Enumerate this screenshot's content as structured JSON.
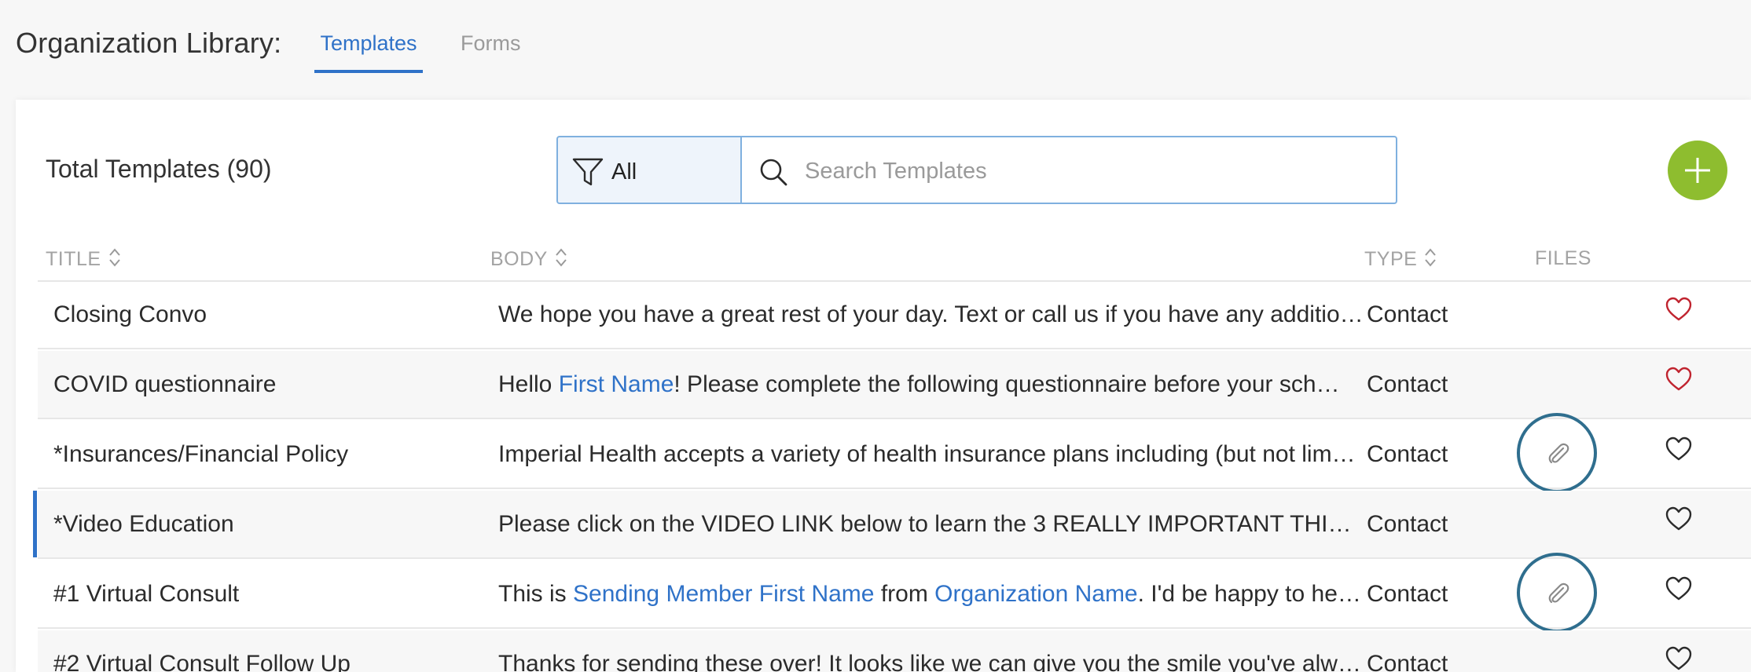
{
  "header": {
    "title": "Organization Library:",
    "tabs": [
      {
        "label": "Templates",
        "active": true
      },
      {
        "label": "Forms",
        "active": false
      }
    ]
  },
  "toolbar": {
    "total_label": "Total Templates (90)",
    "filter_label": "All",
    "search_placeholder": "Search Templates",
    "search_value": "",
    "add_icon": "plus-icon"
  },
  "table": {
    "columns": [
      "TITLE",
      "BODY",
      "TYPE",
      "FILES"
    ],
    "rows": [
      {
        "title": "Closing Convo",
        "body": [
          {
            "t": "We hope you have a great rest of your day. Text or call us if you have any additio…"
          }
        ],
        "type": "Contact",
        "has_files": false,
        "favorite": true
      },
      {
        "title": "COVID questionnaire",
        "body": [
          {
            "t": "Hello "
          },
          {
            "t": "First Name",
            "var": true
          },
          {
            "t": "! Please complete the following questionnaire before your sch…"
          }
        ],
        "type": "Contact",
        "has_files": false,
        "favorite": true
      },
      {
        "title": "*Insurances/Financial Policy",
        "body": [
          {
            "t": "Imperial Health accepts a variety of health insurance plans including (but not lim…"
          }
        ],
        "type": "Contact",
        "has_files": true,
        "favorite": false
      },
      {
        "title": "*Video Education",
        "body": [
          {
            "t": "Please click on the VIDEO LINK below to learn the 3 REALLY IMPORTANT THI…"
          }
        ],
        "type": "Contact",
        "has_files": false,
        "favorite": false
      },
      {
        "title": "#1 Virtual Consult",
        "body": [
          {
            "t": "This is "
          },
          {
            "t": "Sending Member First Name",
            "var": true
          },
          {
            "t": " from "
          },
          {
            "t": "Organization Name",
            "var": true
          },
          {
            "t": ". I'd be happy to he…"
          }
        ],
        "type": "Contact",
        "has_files": true,
        "favorite": false
      },
      {
        "title": "#2 Virtual Consult Follow Up",
        "body": [
          {
            "t": "Thanks for sending these over! It looks like we can give you the smile you've alw…"
          }
        ],
        "type": "Contact",
        "has_files": false,
        "favorite": false
      }
    ]
  },
  "colors": {
    "accent": "#2f72c8",
    "add_button": "#8ebd2f",
    "favorite_heart": "#c0242f",
    "attachment_ring": "#2f6e8e"
  }
}
